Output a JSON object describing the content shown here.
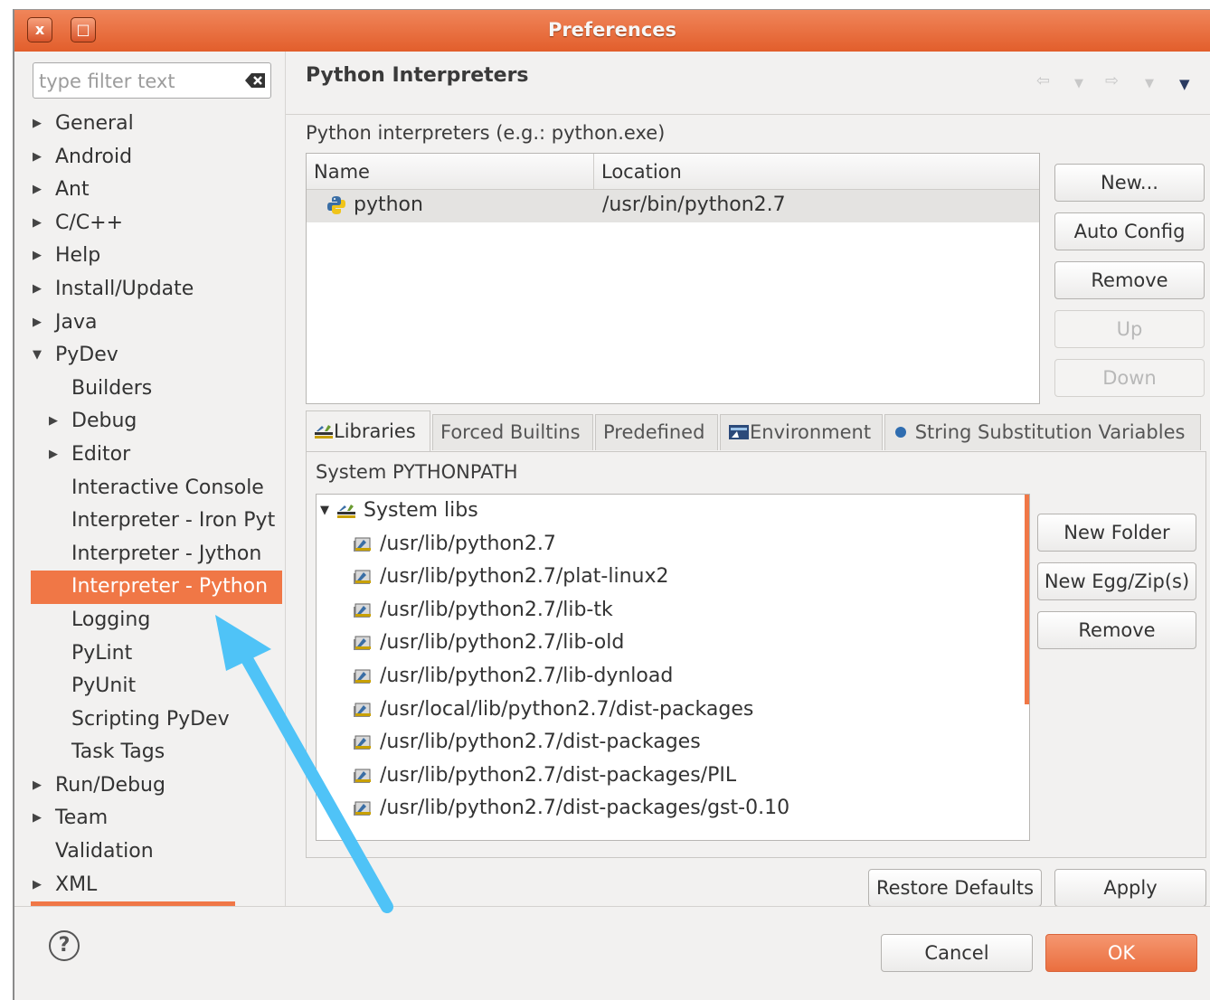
{
  "window": {
    "title": "Preferences",
    "close_label": "x",
    "maximize_label": "□"
  },
  "nav": {
    "filter_placeholder": "type filter text",
    "items": [
      {
        "label": "General",
        "level": 0,
        "arrow": "▶"
      },
      {
        "label": "Android",
        "level": 0,
        "arrow": "▶"
      },
      {
        "label": "Ant",
        "level": 0,
        "arrow": "▶"
      },
      {
        "label": "C/C++",
        "level": 0,
        "arrow": "▶"
      },
      {
        "label": "Help",
        "level": 0,
        "arrow": "▶"
      },
      {
        "label": "Install/Update",
        "level": 0,
        "arrow": "▶"
      },
      {
        "label": "Java",
        "level": 0,
        "arrow": "▶"
      },
      {
        "label": "PyDev",
        "level": 0,
        "arrow": "▼"
      },
      {
        "label": "Builders",
        "level": 1,
        "arrow": ""
      },
      {
        "label": "Debug",
        "level": 1,
        "arrow": "▶"
      },
      {
        "label": "Editor",
        "level": 1,
        "arrow": "▶"
      },
      {
        "label": "Interactive Console",
        "level": 1,
        "arrow": ""
      },
      {
        "label": "Interpreter - Iron Pyt",
        "level": 1,
        "arrow": ""
      },
      {
        "label": "Interpreter - Jython",
        "level": 1,
        "arrow": ""
      },
      {
        "label": "Interpreter - Python",
        "level": 1,
        "arrow": "",
        "selected": true
      },
      {
        "label": "Logging",
        "level": 1,
        "arrow": ""
      },
      {
        "label": "PyLint",
        "level": 1,
        "arrow": ""
      },
      {
        "label": "PyUnit",
        "level": 1,
        "arrow": ""
      },
      {
        "label": "Scripting PyDev",
        "level": 1,
        "arrow": ""
      },
      {
        "label": "Task Tags",
        "level": 1,
        "arrow": ""
      },
      {
        "label": "Run/Debug",
        "level": 0,
        "arrow": "▶"
      },
      {
        "label": "Team",
        "level": 0,
        "arrow": "▶"
      },
      {
        "label": "Validation",
        "level": 0,
        "arrow": ""
      },
      {
        "label": "XML",
        "level": 0,
        "arrow": "▶"
      }
    ]
  },
  "panel": {
    "title": "Python Interpreters",
    "section_label": "Python interpreters (e.g.: python.exe)",
    "table": {
      "columns": [
        "Name",
        "Location"
      ],
      "rows": [
        {
          "name": "python",
          "location": "/usr/bin/python2.7",
          "icon": "python-icon"
        }
      ]
    },
    "buttons": {
      "new": "New...",
      "auto_config": "Auto Config",
      "remove": "Remove",
      "up": "Up",
      "down": "Down"
    },
    "tabs": [
      {
        "label": "Libraries",
        "icon": "libraries-icon",
        "active": true
      },
      {
        "label": "Forced Builtins",
        "icon": ""
      },
      {
        "label": "Predefined",
        "icon": ""
      },
      {
        "label": "Environment",
        "icon": "environment-icon"
      },
      {
        "label": "String Substitution Variables",
        "icon": "bullet-icon"
      }
    ],
    "libraries": {
      "label": "System PYTHONPATH",
      "root": "System libs",
      "paths": [
        "/usr/lib/python2.7",
        "/usr/lib/python2.7/plat-linux2",
        "/usr/lib/python2.7/lib-tk",
        "/usr/lib/python2.7/lib-old",
        "/usr/lib/python2.7/lib-dynload",
        "/usr/local/lib/python2.7/dist-packages",
        "/usr/lib/python2.7/dist-packages",
        "/usr/lib/python2.7/dist-packages/PIL",
        "/usr/lib/python2.7/dist-packages/gst-0.10"
      ],
      "buttons": {
        "new_folder": "New Folder",
        "new_egg": "New Egg/Zip(s)",
        "remove": "Remove"
      }
    },
    "restore_defaults": "Restore Defaults",
    "apply": "Apply"
  },
  "footer": {
    "help_label": "?",
    "cancel": "Cancel",
    "ok": "OK"
  },
  "colors": {
    "accent": "#f07746",
    "titlebar": "#e25e2c",
    "annotation_arrow": "#4fc3f7"
  }
}
